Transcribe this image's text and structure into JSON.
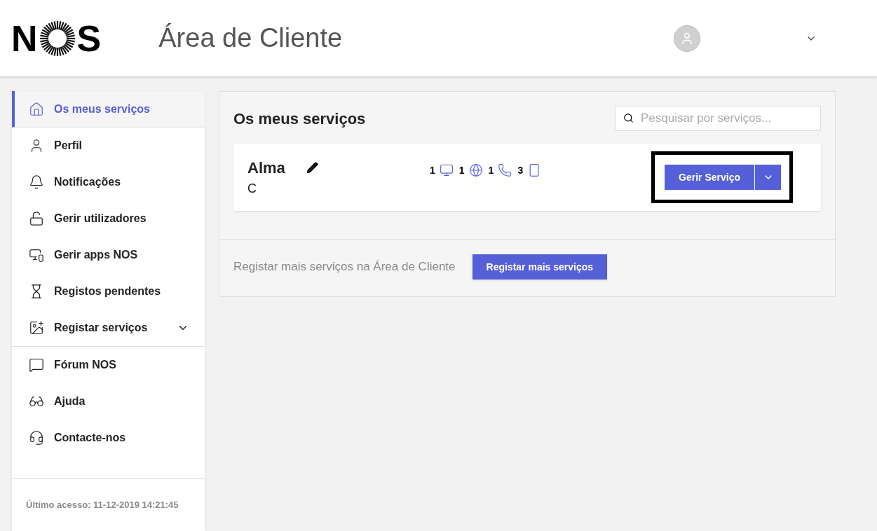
{
  "header": {
    "logo": {
      "left": "N",
      "right": "S"
    },
    "title": "Área de Cliente"
  },
  "sidebar": {
    "groups": [
      [
        {
          "label": "Os meus serviços",
          "selected": true,
          "expandable": false
        },
        {
          "label": "Perfil",
          "selected": false,
          "expandable": false
        },
        {
          "label": "Notificações",
          "selected": false,
          "expandable": false
        },
        {
          "label": "Gerir utilizadores",
          "selected": false,
          "expandable": false
        },
        {
          "label": "Gerir apps NOS",
          "selected": false,
          "expandable": false
        },
        {
          "label": "Registos pendentes",
          "selected": false,
          "expandable": false
        },
        {
          "label": "Registar serviços",
          "selected": false,
          "expandable": true
        }
      ],
      [
        {
          "label": "Fórum NOS",
          "selected": false,
          "expandable": false
        },
        {
          "label": "Ajuda",
          "selected": false,
          "expandable": false
        },
        {
          "label": "Contacte-nos",
          "selected": false,
          "expandable": false
        }
      ]
    ],
    "last_access": "Último acesso: 11-12-2019 14:21:45"
  },
  "main": {
    "title": "Os meus serviços",
    "search": {
      "placeholder": "Pesquisar por serviços..."
    },
    "services": [
      {
        "name": "Alma",
        "subtitle": "C",
        "counts": [
          "1",
          "1",
          "1",
          "3"
        ],
        "button": "Gerir Serviço",
        "highlighted": true
      }
    ],
    "register_text": "Registar mais serviços na Área de Cliente",
    "register_button": "Registar mais serviços"
  }
}
